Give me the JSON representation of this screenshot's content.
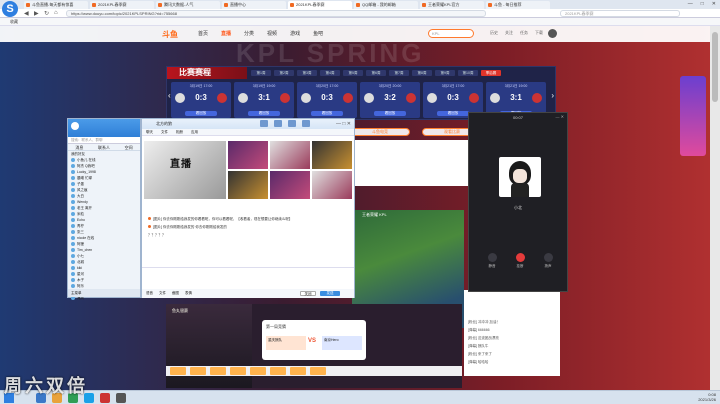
{
  "browser": {
    "tabs": [
      {
        "label": "斗鱼直播-每天都有惊喜",
        "active": false
      },
      {
        "label": "2021KPL春季赛",
        "active": false
      },
      {
        "label": "腾讯大数据-人气",
        "active": false
      },
      {
        "label": "直播中心",
        "active": false
      },
      {
        "label": "2021KPL春季赛",
        "active": true
      },
      {
        "label": "QQ邮箱 - 我的邮箱",
        "active": false
      },
      {
        "label": "王者荣耀KPL官方",
        "active": false
      },
      {
        "label": "斗鱼 - 每日推荐",
        "active": false
      }
    ],
    "url": "https://www.douyu.com/topic/2021KPLSPRING?rid=755668",
    "right_search_placeholder": "2021KPL春季赛",
    "bookmarks_label": "收藏",
    "controls": [
      "—",
      "□",
      "✕"
    ]
  },
  "site": {
    "logo": "斗鱼",
    "nav": [
      "首页",
      "直播",
      "分类",
      "视频",
      "游戏",
      "鱼吧"
    ],
    "active_nav": "直播",
    "search_placeholder": "KPL",
    "header_icons": [
      "历史",
      "关注",
      "任务",
      "下载"
    ],
    "hero_text": "KPL SPRING"
  },
  "schedule": {
    "title": "比赛赛程",
    "tabs": [
      "第1周",
      "第2周",
      "第3周",
      "第4周",
      "第5周",
      "第6周",
      "第7周",
      "第8周",
      "第9周",
      "第10周",
      "季后赛"
    ],
    "matches": [
      {
        "when": "3月19日 17:00",
        "score": "0:3",
        "button": "看回放"
      },
      {
        "when": "3月19日 19:00",
        "score": "3:1",
        "button": "看回放"
      },
      {
        "when": "3月20日 17:00",
        "score": "0:3",
        "button": "看回放"
      },
      {
        "when": "3月20日 20:00",
        "score": "3:2",
        "button": "看回放"
      },
      {
        "when": "3月21日 17:00",
        "score": "0:3",
        "button": "看回放"
      },
      {
        "when": "3月21日 19:00",
        "score": "3:1",
        "button": "看回放"
      }
    ],
    "prev": "‹",
    "next": "›"
  },
  "page_buttons": [
    "斗鱼电竞",
    "观看比赛"
  ],
  "video_overlay": "王者荣耀 KPL",
  "bottom": {
    "yuwan_label": "鱼丸银赛",
    "vs_title": "第一局竞猜",
    "vs_mid": "VS",
    "left_team": "重庆狼队",
    "right_team": "南京Hero"
  },
  "site_chat": [
    "[粉丝] 冲冲冲 加油！",
    "[弹幕] 666666",
    "[粉丝] 这波团战漂亮",
    "[弹幕] 狼队牛",
    "[粉丝] 来了来了",
    "[弹幕] 哈哈哈"
  ],
  "qq_list": {
    "search_placeholder": "搜索：联系人、群聊",
    "tabs": [
      "消息",
      "联系人",
      "空间"
    ],
    "group_label": "我的好友",
    "friends": [
      "小鱼儿 在线",
      "阿杰 Q我吧",
      "Lucky_1998",
      "晨曦 忙碌",
      "子墨",
      "风之痕",
      "大白",
      "Wendy",
      "老王 离开",
      "米粒",
      "Echo",
      "青柠",
      "张三",
      "nicole 在线",
      "阿狸",
      "Tim_chen",
      "小七",
      "北城",
      "kiki",
      "星河",
      "木子",
      "阿乐",
      "Sunny",
      "海风"
    ],
    "bottom_label": "主菜单"
  },
  "chat": {
    "title": "北方的狼",
    "tabs": [
      "聊天",
      "文件",
      "相册",
      "应用"
    ],
    "thumb_caption": "直播",
    "messages": [
      "[图片] 你去你刚刚给我发的你看看呢，你可以看看呢，【收看者，现在想要让你继续么呢】",
      "[图片] 你去你刚刚给我发的 你去你刚刚给我发的",
      "？？？？？"
    ],
    "close_button": "关闭",
    "send_button": "发送",
    "input_tools": [
      "表情",
      "截图",
      "文件",
      "语音"
    ]
  },
  "call": {
    "time": "00:07",
    "name": "小北",
    "buttons": [
      "静音",
      "挂断",
      "扬声"
    ]
  },
  "taskbar": {
    "time": "0:08",
    "date": "2021/3/26"
  },
  "watermark": "周六双倍"
}
